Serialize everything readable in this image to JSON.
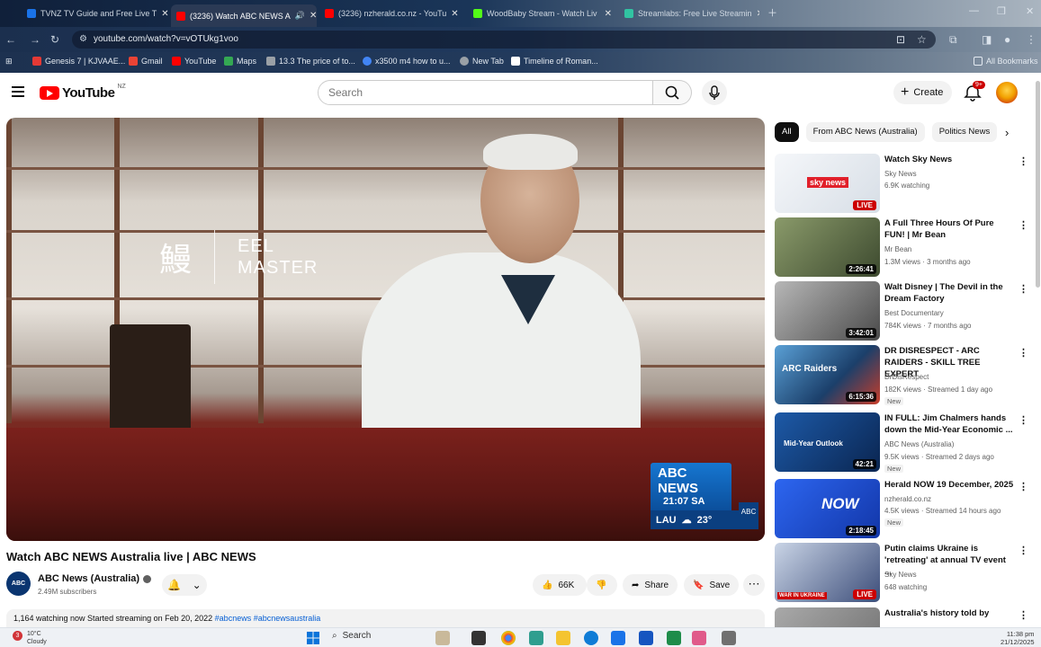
{
  "browser": {
    "tabs": [
      {
        "title": "TVNZ TV Guide and Free Live T",
        "color": "#1a73e8"
      },
      {
        "title": "(3236) Watch ABC NEWS A",
        "color": "#ff0000",
        "active": true
      },
      {
        "title": "(3236) nzherald.co.nz - YouTu",
        "color": "#ff0000"
      },
      {
        "title": "WoodBaby Stream - Watch Liv",
        "color": "#53fc18"
      },
      {
        "title": "Streamlabs: Free Live Streamin",
        "color": "#31c3a2"
      }
    ],
    "url": "youtube.com/watch?v=vOTUkg1voo",
    "bookmarks": [
      {
        "label": "Genesis 7 | KJVAAE...",
        "color": "#e53935"
      },
      {
        "label": "Gmail",
        "color": "#ea4335"
      },
      {
        "label": "YouTube",
        "color": "#ff0000"
      },
      {
        "label": "Maps",
        "color": "#34a853"
      },
      {
        "label": "13.3 The price of to...",
        "color": "#9aa0a6"
      },
      {
        "label": "x3500 m4 how to u...",
        "color": "#4285f4"
      },
      {
        "label": "New Tab",
        "color": "#9aa0a6"
      },
      {
        "label": "Timeline of Roman...",
        "color": "#ffffff"
      }
    ],
    "all_bookmarks": "All Bookmarks"
  },
  "youtube": {
    "logo_text": "YouTube",
    "region": "NZ",
    "search_placeholder": "Search",
    "create_label": "Create",
    "notif_badge": "9+"
  },
  "video": {
    "overlay_kanji": "鰻",
    "overlay_line1": "EEL",
    "overlay_line2": "MASTER",
    "bug_brand": "ABC NEWS",
    "bug_time": "21:07 SA",
    "bug_location": "LAU",
    "bug_temp": "23°",
    "title": "Watch ABC NEWS Australia live | ABC NEWS",
    "channel": "ABC News (Australia)",
    "subscribers": "2.49M subscribers",
    "likes": "66K",
    "share": "Share",
    "save": "Save",
    "desc_stats": "1,164 watching now  Started streaming on Feb 20, 2022",
    "desc_tags": "#abcnews #abcnewsaustralia"
  },
  "chips": [
    {
      "label": "All",
      "selected": true
    },
    {
      "label": "From ABC News (Australia)"
    },
    {
      "label": "Politics News"
    }
  ],
  "recommendations": [
    {
      "title": "Watch Sky News",
      "channel": "Sky News",
      "meta": "6.9K watching",
      "badge": "LIVE",
      "thumb": "#e9eef3",
      "thumbText": "sky news"
    },
    {
      "title": "A Full Three Hours Of Pure FUN! | Mr Bean",
      "channel": "Mr Bean",
      "meta": "1.3M views · 3 months ago",
      "duration": "2:26:41",
      "thumb": "#5d6a4a",
      "thumbText": ""
    },
    {
      "title": "Walt Disney | The Devil in the Dream Factory",
      "channel": "Best Documentary",
      "meta": "784K views · 7 months ago",
      "duration": "3:42:01",
      "thumb": "#7d7d7d",
      "thumbText": ""
    },
    {
      "title": "DR DISRESPECT - ARC RAIDERS - SKILL TREE EXPERT",
      "channel": "DrDisRespect",
      "meta": "182K views · Streamed 1 day ago",
      "duration": "6:15:36",
      "new": "New",
      "thumb": "#2e5a8c",
      "thumbText": "ARC Raiders"
    },
    {
      "title": "IN FULL: Jim Chalmers hands down the Mid-Year Economic ...",
      "channel": "ABC News (Australia)",
      "meta": "9.5K views · Streamed 2 days ago",
      "duration": "42:21",
      "new": "New",
      "thumb": "#0d3b7a",
      "thumbText": "Mid-Year Outlook"
    },
    {
      "title": "Herald NOW 19 December, 2025",
      "channel": "nzherald.co.nz",
      "meta": "4.5K views · Streamed 14 hours ago",
      "duration": "2:18:45",
      "new": "New",
      "thumb": "#1c4fd8",
      "thumbText": "NOW"
    },
    {
      "title": "Putin claims Ukraine is 'retreating' at annual TV event ...",
      "channel": "Sky News",
      "meta": "648 watching",
      "badge": "LIVE",
      "thumb": "#3d4e7a",
      "thumbText": "WAR IN UKRAINE"
    },
    {
      "title": "Australia's history told by",
      "channel": "",
      "meta": "",
      "thumb": "#8a8a8a",
      "thumbText": ""
    }
  ],
  "taskbar": {
    "weather_badge": "3",
    "temp": "10°C",
    "condition": "Cloudy",
    "search": "Search",
    "time": "11:38 pm",
    "date": "21/12/2025"
  }
}
